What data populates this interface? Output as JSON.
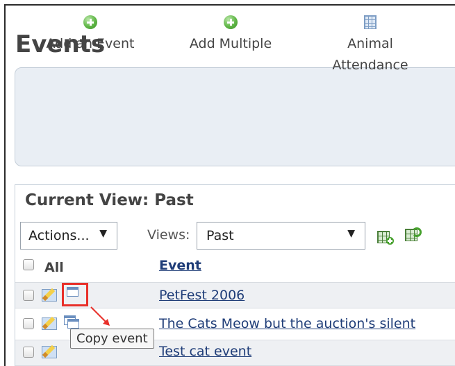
{
  "page": {
    "title": "Events"
  },
  "toolbar": {
    "items": [
      {
        "label": "Add an Event",
        "icon": "add-circle-icon"
      },
      {
        "label": "Add Multiple",
        "icon": "add-circle-icon"
      },
      {
        "label": "Animal Attendance",
        "icon": "spreadsheet-icon"
      }
    ]
  },
  "panel": {
    "title": "Current View: Past",
    "actions_label": "Actions...",
    "views_label": "Views:",
    "views_value": "Past",
    "arrow": "▼"
  },
  "table": {
    "select_all_label": "All",
    "column_event": "Event",
    "rows": [
      {
        "event": "PetFest 2006"
      },
      {
        "event": "The Cats Meow but the auction's silent"
      },
      {
        "event": "Test cat event"
      }
    ]
  },
  "tooltip": {
    "text": "Copy event"
  },
  "colors": {
    "annotation": "#e8302a",
    "link": "#1f3d78",
    "toolbar_bg": "#e9eef4"
  }
}
